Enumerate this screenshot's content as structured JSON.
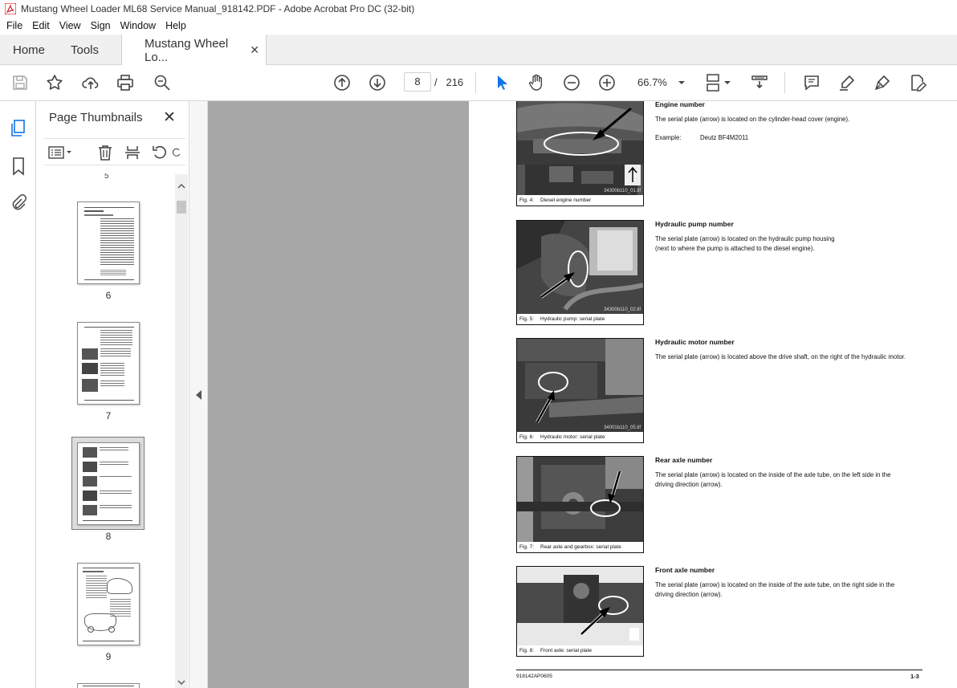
{
  "window": {
    "title": "Mustang Wheel Loader ML68 Service Manual_918142.PDF - Adobe Acrobat Pro DC (32-bit)"
  },
  "menu": [
    "File",
    "Edit",
    "View",
    "Sign",
    "Window",
    "Help"
  ],
  "tabs": {
    "home": "Home",
    "tools": "Tools",
    "document": "Mustang Wheel Lo...",
    "close": "✕"
  },
  "toolbar": {
    "current_page": "8",
    "page_sep": "/",
    "total_pages": "216",
    "zoom": "66.7%"
  },
  "panel": {
    "title": "Page Thumbnails",
    "close": "✕",
    "thumbnails": [
      {
        "label": "6"
      },
      {
        "label": "7"
      },
      {
        "label": "8",
        "selected": true
      },
      {
        "label": "9"
      }
    ]
  },
  "document": {
    "sections": [
      {
        "heading": "Engine number",
        "text": "The serial plate (arrow) is located on the cylinder-head cover (engine).",
        "fig_no": "Fig. 4:",
        "fig_caption": "Diesel engine number",
        "fig_file": "34300b110_01.tif"
      },
      {
        "heading": "Hydraulic pump number",
        "text": "The serial plate (arrow) is located on the hydraulic pump housing",
        "text2": "(next to where the pump is attached to the diesel engine).",
        "fig_no": "Fig. 5:",
        "fig_caption": "Hydraulic pump: serial plate",
        "fig_file": "34300b110_02.tif"
      },
      {
        "heading": "Hydraulic motor number",
        "text": "The serial plate (arrow) is located above the drive shaft, on the right of the hydraulic motor.",
        "fig_no": "Fig. 6:",
        "fig_caption": "Hydraulic motor: serial plate",
        "fig_file": "34001b110_05.tif"
      },
      {
        "heading": "Rear axle number",
        "text": "The serial plate (arrow) is located on the inside of the axle tube, on the left side in the",
        "text2": "driving direction (arrow).",
        "fig_no": "Fig. 7:",
        "fig_caption": "Rear axle and gearbox: serial plate"
      },
      {
        "heading": "Front axle number",
        "text": "The serial plate (arrow) is located on the inside of the axle tube, on the right side in the",
        "text2": "driving direction (arrow).",
        "fig_no": "Fig. 8:",
        "fig_caption": "Front axle: serial plate"
      }
    ],
    "example_label": "Example:",
    "example_value": "Deutz BF4M2011",
    "footer_left": "918142AP0605",
    "footer_right": "1-3"
  },
  "colors": {
    "accent_blue": "#1473e6",
    "acrobat_red": "#d4262a",
    "canvas_gray": "#a7a7a7"
  }
}
